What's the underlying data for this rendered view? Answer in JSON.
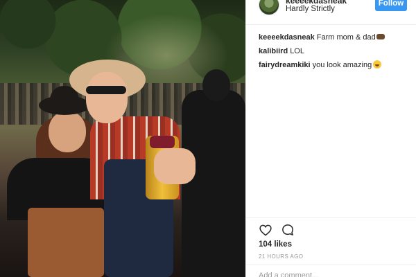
{
  "post": {
    "username": "keeeekdasneak",
    "location": "Hardly Strictly",
    "follow_label": "Follow"
  },
  "comments": [
    {
      "username": "keeeekdasneak",
      "text": "Farm mom & dad",
      "emoji": "cow-emoji"
    },
    {
      "username": "kalibiird",
      "text": "LOL",
      "emoji": ""
    },
    {
      "username": "fairydreamkiki",
      "text": "you look amazing",
      "emoji": "smiling-face-emoji"
    }
  ],
  "engagement": {
    "likes": "104 likes",
    "timestamp": "21 HOURS AGO"
  },
  "comment_box": {
    "placeholder": "Add a comment..."
  },
  "icons": {
    "like": "heart-icon",
    "comment": "comment-bubble-icon"
  },
  "colors": {
    "accent": "#3897f0",
    "text": "#262626",
    "muted": "#999999",
    "divider": "#efefef"
  }
}
